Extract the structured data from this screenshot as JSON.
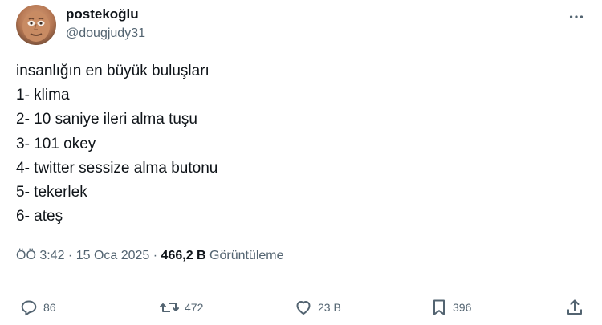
{
  "author": {
    "display_name": "postekoğlu",
    "handle": "@dougjudy31"
  },
  "tweet": {
    "text": "insanlığın en büyük buluşları\n1- klima\n2- 10 saniye ileri alma tuşu\n3- 101 okey\n4- twitter sessize alma butonu\n5- tekerlek\n6- ateş"
  },
  "meta": {
    "time": "ÖÖ 3:42",
    "dot": " · ",
    "date": "15 Oca 2025",
    "dot2": " · ",
    "views_count": "466,2 B",
    "views_label": " Görüntüleme"
  },
  "actions": {
    "replies": "86",
    "reposts": "472",
    "likes": "23 B",
    "bookmarks": "396"
  },
  "icons": {
    "more": "more-icon",
    "reply": "reply-icon",
    "repost": "repost-icon",
    "like": "heart-icon",
    "bookmark": "bookmark-icon",
    "share": "share-icon"
  },
  "colors": {
    "text": "#0f1419",
    "secondary": "#536471",
    "divider": "#eff3f4"
  }
}
